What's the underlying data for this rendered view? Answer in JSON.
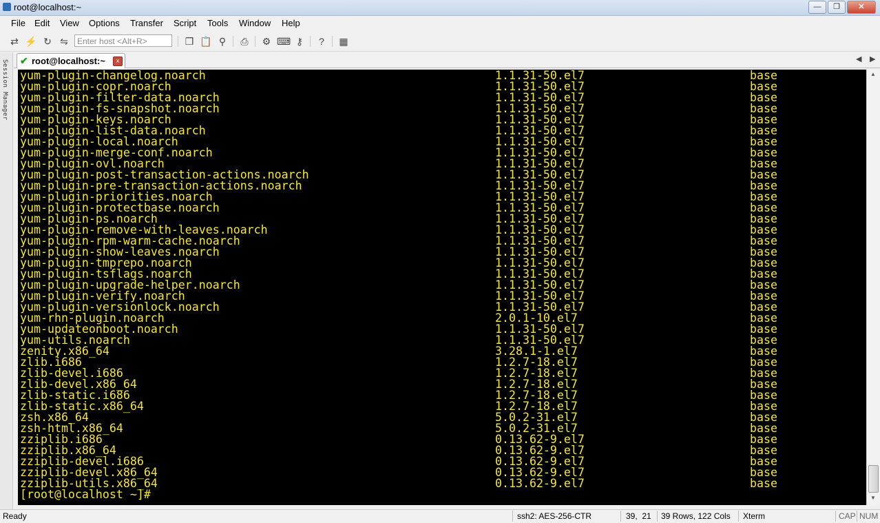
{
  "window": {
    "title": "root@localhost:~"
  },
  "menu": [
    "File",
    "Edit",
    "View",
    "Options",
    "Transfer",
    "Script",
    "Tools",
    "Window",
    "Help"
  ],
  "toolbar": {
    "host_placeholder": "Enter host <Alt+R>"
  },
  "session_manager": {
    "label": "Session Manager"
  },
  "tab": {
    "label": "root@localhost:~",
    "close": "x"
  },
  "terminal": {
    "rows": [
      [
        "yum-plugin-changelog.noarch",
        "1.1.31-50.el7",
        "base"
      ],
      [
        "yum-plugin-copr.noarch",
        "1.1.31-50.el7",
        "base"
      ],
      [
        "yum-plugin-filter-data.noarch",
        "1.1.31-50.el7",
        "base"
      ],
      [
        "yum-plugin-fs-snapshot.noarch",
        "1.1.31-50.el7",
        "base"
      ],
      [
        "yum-plugin-keys.noarch",
        "1.1.31-50.el7",
        "base"
      ],
      [
        "yum-plugin-list-data.noarch",
        "1.1.31-50.el7",
        "base"
      ],
      [
        "yum-plugin-local.noarch",
        "1.1.31-50.el7",
        "base"
      ],
      [
        "yum-plugin-merge-conf.noarch",
        "1.1.31-50.el7",
        "base"
      ],
      [
        "yum-plugin-ovl.noarch",
        "1.1.31-50.el7",
        "base"
      ],
      [
        "yum-plugin-post-transaction-actions.noarch",
        "1.1.31-50.el7",
        "base"
      ],
      [
        "yum-plugin-pre-transaction-actions.noarch",
        "1.1.31-50.el7",
        "base"
      ],
      [
        "yum-plugin-priorities.noarch",
        "1.1.31-50.el7",
        "base"
      ],
      [
        "yum-plugin-protectbase.noarch",
        "1.1.31-50.el7",
        "base"
      ],
      [
        "yum-plugin-ps.noarch",
        "1.1.31-50.el7",
        "base"
      ],
      [
        "yum-plugin-remove-with-leaves.noarch",
        "1.1.31-50.el7",
        "base"
      ],
      [
        "yum-plugin-rpm-warm-cache.noarch",
        "1.1.31-50.el7",
        "base"
      ],
      [
        "yum-plugin-show-leaves.noarch",
        "1.1.31-50.el7",
        "base"
      ],
      [
        "yum-plugin-tmprepo.noarch",
        "1.1.31-50.el7",
        "base"
      ],
      [
        "yum-plugin-tsflags.noarch",
        "1.1.31-50.el7",
        "base"
      ],
      [
        "yum-plugin-upgrade-helper.noarch",
        "1.1.31-50.el7",
        "base"
      ],
      [
        "yum-plugin-verify.noarch",
        "1.1.31-50.el7",
        "base"
      ],
      [
        "yum-plugin-versionlock.noarch",
        "1.1.31-50.el7",
        "base"
      ],
      [
        "yum-rhn-plugin.noarch",
        "2.0.1-10.el7",
        "base"
      ],
      [
        "yum-updateonboot.noarch",
        "1.1.31-50.el7",
        "base"
      ],
      [
        "yum-utils.noarch",
        "1.1.31-50.el7",
        "base"
      ],
      [
        "zenity.x86_64",
        "3.28.1-1.el7",
        "base"
      ],
      [
        "zlib.i686",
        "1.2.7-18.el7",
        "base"
      ],
      [
        "zlib-devel.i686",
        "1.2.7-18.el7",
        "base"
      ],
      [
        "zlib-devel.x86_64",
        "1.2.7-18.el7",
        "base"
      ],
      [
        "zlib-static.i686",
        "1.2.7-18.el7",
        "base"
      ],
      [
        "zlib-static.x86_64",
        "1.2.7-18.el7",
        "base"
      ],
      [
        "zsh.x86_64",
        "5.0.2-31.el7",
        "base"
      ],
      [
        "zsh-html.x86_64",
        "5.0.2-31.el7",
        "base"
      ],
      [
        "zziplib.i686",
        "0.13.62-9.el7",
        "base"
      ],
      [
        "zziplib.x86_64",
        "0.13.62-9.el7",
        "base"
      ],
      [
        "zziplib-devel.i686",
        "0.13.62-9.el7",
        "base"
      ],
      [
        "zziplib-devel.x86_64",
        "0.13.62-9.el7",
        "base"
      ],
      [
        "zziplib-utils.x86_64",
        "0.13.62-9.el7",
        "base"
      ]
    ],
    "prompt": "[root@localhost ~]#"
  },
  "status": {
    "ready": "Ready",
    "cipher": "ssh2: AES-256-CTR",
    "cursor": "39,  21",
    "size": "39 Rows, 122 Cols",
    "term": "Xterm",
    "cap": "CAP",
    "num": "NUM"
  }
}
